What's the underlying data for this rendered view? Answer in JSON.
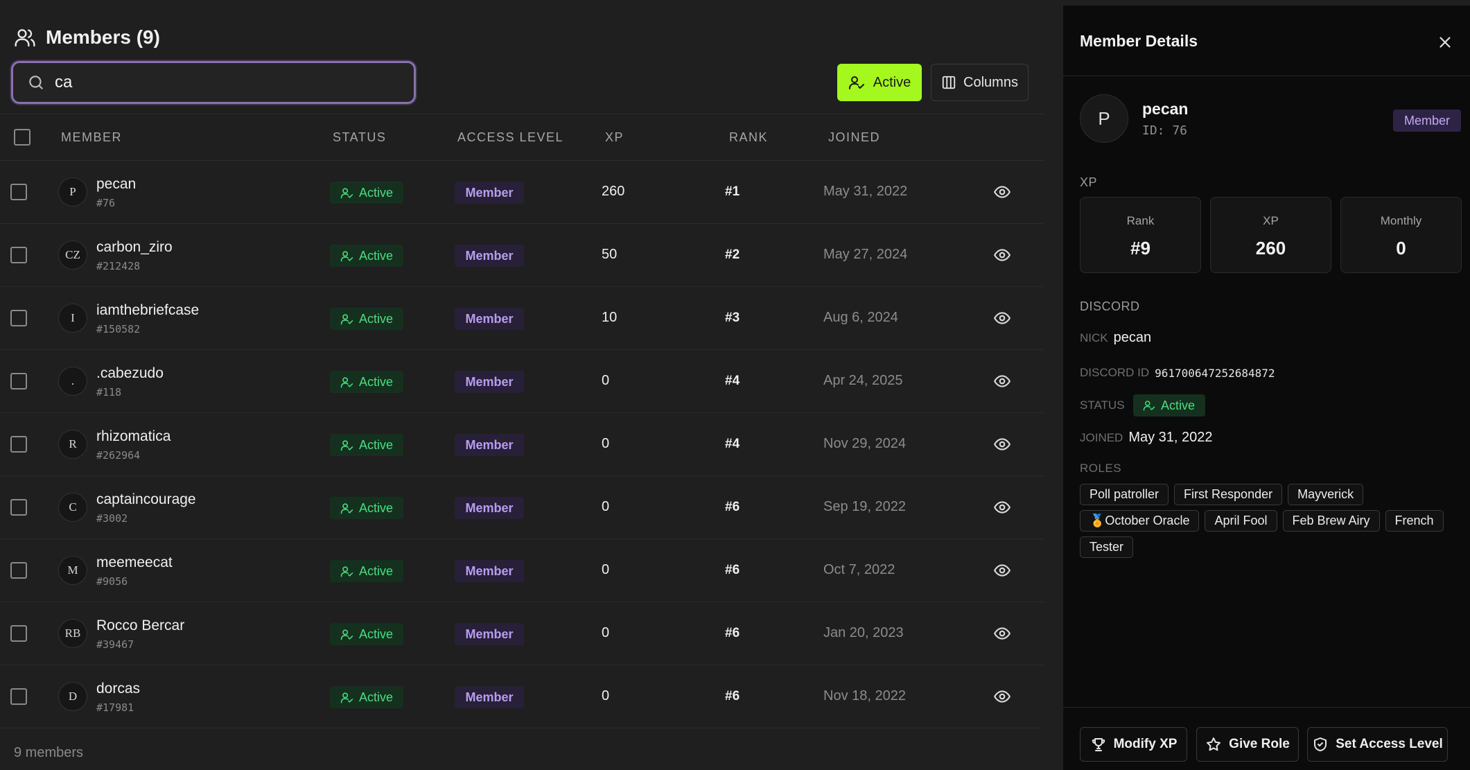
{
  "header": {
    "title": "Members (9)",
    "icon": "users-icon"
  },
  "search": {
    "value": "ca",
    "placeholder": ""
  },
  "toolbar": {
    "active_label": "Active",
    "columns_label": "Columns"
  },
  "table": {
    "columns": [
      "MEMBER",
      "STATUS",
      "ACCESS LEVEL",
      "XP",
      "RANK",
      "JOINED"
    ],
    "rows": [
      {
        "initials": "P",
        "name": "pecan",
        "id": "#76",
        "status": "Active",
        "level": "Member",
        "xp": "260",
        "rank": "#1",
        "joined": "May 31, 2022"
      },
      {
        "initials": "CZ",
        "name": "carbon_ziro",
        "id": "#212428",
        "status": "Active",
        "level": "Member",
        "xp": "50",
        "rank": "#2",
        "joined": "May 27, 2024"
      },
      {
        "initials": "I",
        "name": "iamthebriefcase",
        "id": "#150582",
        "status": "Active",
        "level": "Member",
        "xp": "10",
        "rank": "#3",
        "joined": "Aug 6, 2024"
      },
      {
        "initials": ".",
        "name": ".cabezudo",
        "id": "#118",
        "status": "Active",
        "level": "Member",
        "xp": "0",
        "rank": "#4",
        "joined": "Apr 24, 2025"
      },
      {
        "initials": "R",
        "name": "rhizomatica",
        "id": "#262964",
        "status": "Active",
        "level": "Member",
        "xp": "0",
        "rank": "#4",
        "joined": "Nov 29, 2024"
      },
      {
        "initials": "C",
        "name": "captaincourage",
        "id": "#3002",
        "status": "Active",
        "level": "Member",
        "xp": "0",
        "rank": "#6",
        "joined": "Sep 19, 2022"
      },
      {
        "initials": "M",
        "name": "meemeecat",
        "id": "#9056",
        "status": "Active",
        "level": "Member",
        "xp": "0",
        "rank": "#6",
        "joined": "Oct 7, 2022"
      },
      {
        "initials": "RB",
        "name": "Rocco Bercar",
        "id": "#39467",
        "status": "Active",
        "level": "Member",
        "xp": "0",
        "rank": "#6",
        "joined": "Jan 20, 2023"
      },
      {
        "initials": "D",
        "name": "dorcas",
        "id": "#17981",
        "status": "Active",
        "level": "Member",
        "xp": "0",
        "rank": "#6",
        "joined": "Nov 18, 2022"
      }
    ]
  },
  "footer": {
    "count": "9 members"
  },
  "details": {
    "title": "Member Details",
    "initials": "P",
    "name": "pecan",
    "id": "ID: 76",
    "role_badge": "Member",
    "xp_section": "XP",
    "stats": [
      {
        "label": "Rank",
        "value": "#9"
      },
      {
        "label": "XP",
        "value": "260"
      },
      {
        "label": "Monthly",
        "value": "0"
      }
    ],
    "discord_section": "DISCORD",
    "nick_label": "NICK",
    "nick": "pecan",
    "discord_id_label": "DISCORD ID",
    "discord_id": "961700647252684872",
    "status_label": "STATUS",
    "status": "Active",
    "joined_label": "JOINED",
    "joined": "May 31, 2022",
    "roles_label": "ROLES",
    "roles": [
      "Poll patroller",
      "First Responder",
      "Mayverick",
      "🏅October Oracle",
      "April Fool",
      "Feb Brew Airy",
      "French",
      "Tester"
    ],
    "actions": {
      "modify_xp": "Modify XP",
      "give_role": "Give Role",
      "set_access": "Set Access Level"
    }
  },
  "colors": {
    "accent_green": "#a4f81d",
    "status_green": "#4ade80",
    "member_purple": "#b89cf0",
    "search_border": "#8b6fb5"
  }
}
